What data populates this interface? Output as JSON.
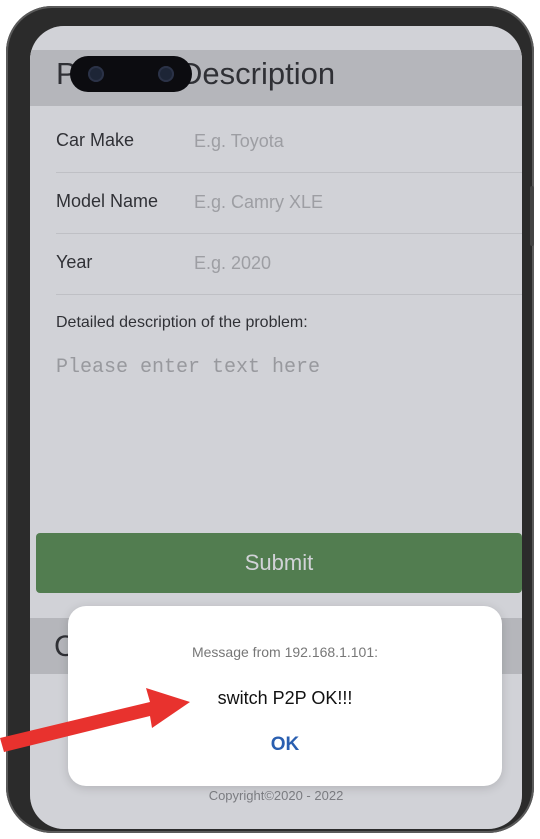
{
  "page": {
    "title": "Problem Description",
    "section2_title_partial": "C",
    "copyright": "Copyright©2020 - 2022"
  },
  "form": {
    "car_make": {
      "label": "Car Make",
      "placeholder": "E.g. Toyota"
    },
    "model_name": {
      "label": "Model Name",
      "placeholder": "E.g. Camry XLE"
    },
    "year": {
      "label": "Year",
      "placeholder": "E.g. 2020"
    },
    "description": {
      "label": "Detailed description of the problem:",
      "placeholder": "Please enter text here"
    },
    "submit_label": "Submit"
  },
  "dialog": {
    "source": "Message from 192.168.1.101:",
    "message": "switch P2P OK!!!",
    "ok_label": "OK"
  },
  "colors": {
    "submit_bg": "#4f8a44",
    "header_band": "#d9d9d9",
    "ok_text": "#2a5fb0",
    "annotation_arrow": "#e8322e"
  }
}
